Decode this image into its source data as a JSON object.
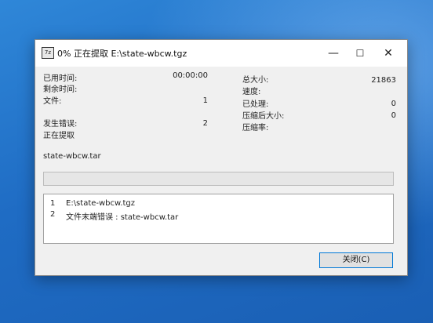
{
  "window": {
    "title": "0% 正在提取 E:\\state-wbcw.tgz",
    "icon_text": "7z",
    "min_glyph": "—",
    "max_glyph": "☐",
    "close_glyph": "✕"
  },
  "stats_left": [
    {
      "label": "已用时间:",
      "value": "00:00:00"
    },
    {
      "label": "剩余时间:",
      "value": ""
    },
    {
      "label": "文件:",
      "value": "1"
    },
    {
      "label": "发生错误:",
      "value": "2"
    },
    {
      "label": "正在提取",
      "value": ""
    }
  ],
  "stats_right": [
    {
      "label": "总大小:",
      "value": "21863"
    },
    {
      "label": "速度:",
      "value": ""
    },
    {
      "label": "已处理:",
      "value": "0"
    },
    {
      "label": "压缩后大小:",
      "value": "0"
    },
    {
      "label": "压缩率:",
      "value": ""
    }
  ],
  "current_file": "state-wbcw.tar",
  "progress": {
    "fraction": 0.0,
    "color": "#06b025"
  },
  "log": [
    {
      "no": "1",
      "text": "E:\\state-wbcw.tgz"
    },
    {
      "no": "2",
      "text": "文件末端错误 : state-wbcw.tar"
    }
  ],
  "buttons": {
    "close": "关闭(C)"
  },
  "colors": {
    "desktop": "#1f6cc4",
    "accent": "#0078d7"
  }
}
